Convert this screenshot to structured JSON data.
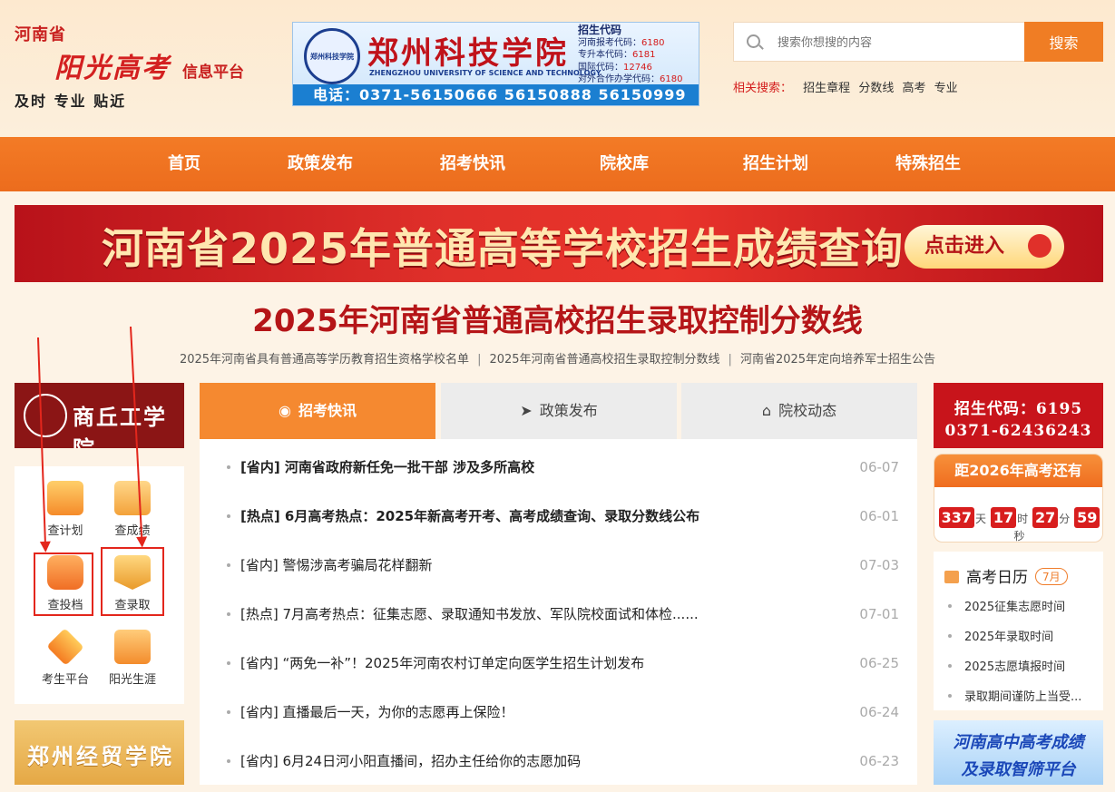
{
  "header": {
    "logo_province": "河南省",
    "logo_main": "阳光高考",
    "logo_sub": "信息平台",
    "logo_slogan": "及时 专业 贴近"
  },
  "ad_top": {
    "seal_text": "郑州科技学院",
    "school": "郑州科技学院",
    "school_en": "ZHENGZHOU UNIVERSITY OF SCIENCE AND TECHNOLOGY",
    "codes_title": "招生代码",
    "codes": [
      {
        "label": "河南报考代码：",
        "value": "6180"
      },
      {
        "label": "专升本代码：",
        "value": "6181"
      },
      {
        "label": "国际代码：",
        "value": "12746"
      },
      {
        "label": "对外合作办学代码：",
        "value": "6180"
      }
    ],
    "phone": "电话：0371-56150666 56150888 56150999"
  },
  "search": {
    "placeholder": "搜索你想搜的内容",
    "button": "搜索",
    "related_label": "相关搜索：",
    "related": [
      "招生章程",
      "分数线",
      "高考",
      "专业"
    ]
  },
  "nav": {
    "items": [
      "首页",
      "政策发布",
      "招考快讯",
      "院校库",
      "招生计划",
      "特殊招生"
    ]
  },
  "banner": {
    "text": "河南省2025年普通高等学校招生成绩查询",
    "enter": "点击进入"
  },
  "headline": "2025年河南省普通高校招生录取控制分数线",
  "sublinks": [
    "2025年河南省具有普通高等学历教育招生资格学校名单",
    "2025年河南省普通高校招生录取控制分数线",
    "河南省2025年定向培养军士招生公告"
  ],
  "sublinks_sep": "|",
  "ad_left1": {
    "name": "商丘工学院"
  },
  "tools": [
    {
      "label": "查计划",
      "icon": "chart-icon"
    },
    {
      "label": "查成绩",
      "icon": "score-icon"
    },
    {
      "label": "查投档",
      "icon": "file-box-icon"
    },
    {
      "label": "查录取",
      "icon": "badge-star-icon"
    },
    {
      "label": "考生平台",
      "icon": "layers-icon"
    },
    {
      "label": "阳光生涯",
      "icon": "book-icon"
    }
  ],
  "ad_left2": {
    "name": "郑州经贸学院"
  },
  "tabs": [
    {
      "label": "招考快讯",
      "icon": "location-icon",
      "active": true
    },
    {
      "label": "政策发布",
      "icon": "send-icon",
      "active": false
    },
    {
      "label": "院校动态",
      "icon": "building-icon",
      "active": false
    }
  ],
  "news": [
    {
      "title": "[省内]  河南省政府新任免一批干部 涉及多所高校",
      "date": "06-07",
      "bold": true
    },
    {
      "title": "[热点]  6月高考热点：2025年新高考开考、高考成绩查询、录取分数线公布",
      "date": "06-01",
      "bold": true
    },
    {
      "title": "[省内]  警惕涉高考骗局花样翻新",
      "date": "07-03",
      "bold": false
    },
    {
      "title": "[热点]  7月高考热点：征集志愿、录取通知书发放、军队院校面试和体检......",
      "date": "07-01",
      "bold": false
    },
    {
      "title": "[省内]  “两免一补”！2025年河南农村订单定向医学生招生计划发布",
      "date": "06-25",
      "bold": false
    },
    {
      "title": "[省内]  直播最后一天，为你的志愿再上保险！",
      "date": "06-24",
      "bold": false
    },
    {
      "title": "[省内]  6月24日河小阳直播间，招办主任给你的志愿加码",
      "date": "06-23",
      "bold": false
    }
  ],
  "ad_right1": {
    "line1": "招生代码：6195",
    "line2": "0371-62436243"
  },
  "countdown": {
    "title": "距2026年高考还有",
    "days": "337",
    "days_unit": "天",
    "hours": "17",
    "hours_unit": "时",
    "minutes": "27",
    "minutes_unit": "分",
    "seconds": "59",
    "seconds_unit": "秒"
  },
  "calendar": {
    "title": "高考日历",
    "month": "7月",
    "items": [
      "2025征集志愿时间",
      "2025年录取时间",
      "2025志愿填报时间",
      "录取期间谨防上当受..."
    ]
  },
  "ad_right2": {
    "line1": "河南高中高考成绩",
    "line2": "及录取智筛平台"
  },
  "colors": {
    "accent": "#f07d24",
    "nav": "#ef711f",
    "red": "#b51518",
    "highlight": "#e3261c"
  }
}
